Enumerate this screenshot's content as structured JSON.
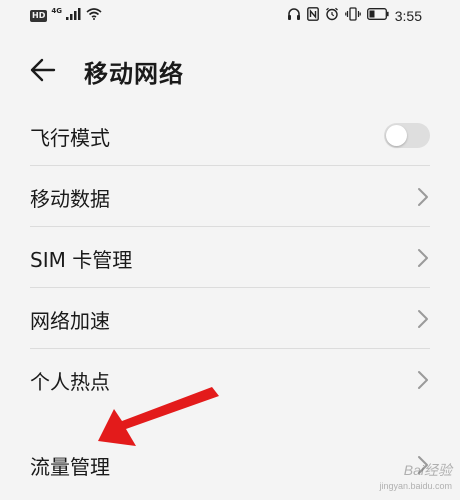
{
  "status_bar": {
    "left_badge": "HD",
    "network_type": "4G",
    "time": "3:55"
  },
  "header": {
    "title": "移动网络"
  },
  "settings": {
    "items": [
      {
        "label": "飞行模式",
        "control": "toggle",
        "enabled": false
      },
      {
        "label": "移动数据",
        "control": "chevron"
      },
      {
        "label": "SIM 卡管理",
        "control": "chevron"
      },
      {
        "label": "网络加速",
        "control": "chevron"
      },
      {
        "label": "个人热点",
        "control": "chevron"
      },
      {
        "label": "流量管理",
        "control": "chevron"
      }
    ]
  },
  "annotation": {
    "arrow_color": "#e31b1b"
  },
  "watermark": {
    "text": "Bai经验",
    "sub": "jingyan.baidu.com"
  },
  "colors": {
    "background": "#f4f4f4",
    "divider": "#dcdcdc",
    "toggle_off": "#dedede"
  }
}
